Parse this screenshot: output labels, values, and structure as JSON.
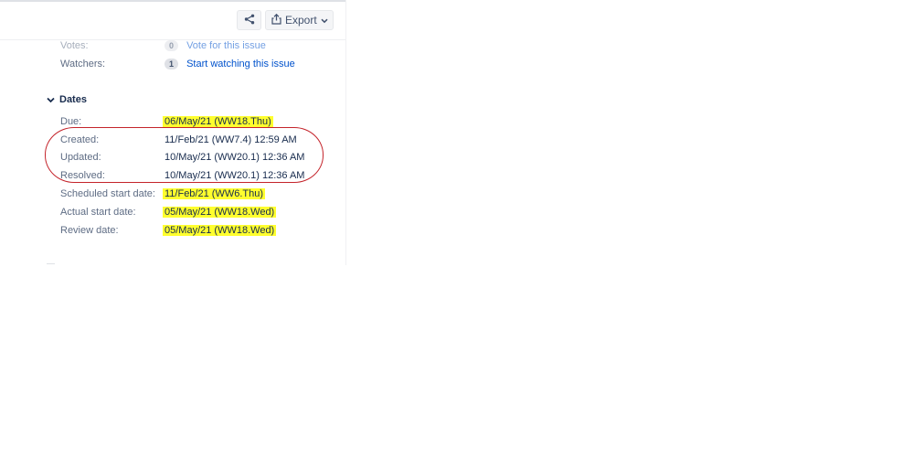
{
  "toolbar": {
    "share_icon": "share-icon",
    "export_label": "Export",
    "export_icon": "export-icon",
    "chevron_icon": "chevron-down-icon"
  },
  "people": {
    "votes": {
      "label": "Votes:",
      "count": "0",
      "action": "Vote for this issue"
    },
    "watchers": {
      "label": "Watchers:",
      "count": "1",
      "action": "Start watching this issue"
    }
  },
  "dates": {
    "title": "Dates",
    "rows": [
      {
        "label": "Due:",
        "value": "06/May/21 (WW18.Thu)"
      },
      {
        "label": "Created:",
        "value": "11/Feb/21 (WW7.4) 12:59 AM"
      },
      {
        "label": "Updated:",
        "value": "10/May/21 (WW20.1) 12:36 AM"
      },
      {
        "label": "Resolved:",
        "value": "10/May/21 (WW20.1) 12:36 AM"
      },
      {
        "label": "Scheduled start date:",
        "value": "11/Feb/21 (WW6.Thu)"
      },
      {
        "label": "Actual start date:",
        "value": "05/May/21 (WW18.Wed)"
      },
      {
        "label": "Review date:",
        "value": "05/May/21 (WW18.Wed)"
      }
    ]
  },
  "colors": {
    "highlight": "#ffff2e",
    "annotation": "#c4242b",
    "link": "#0052cc"
  }
}
